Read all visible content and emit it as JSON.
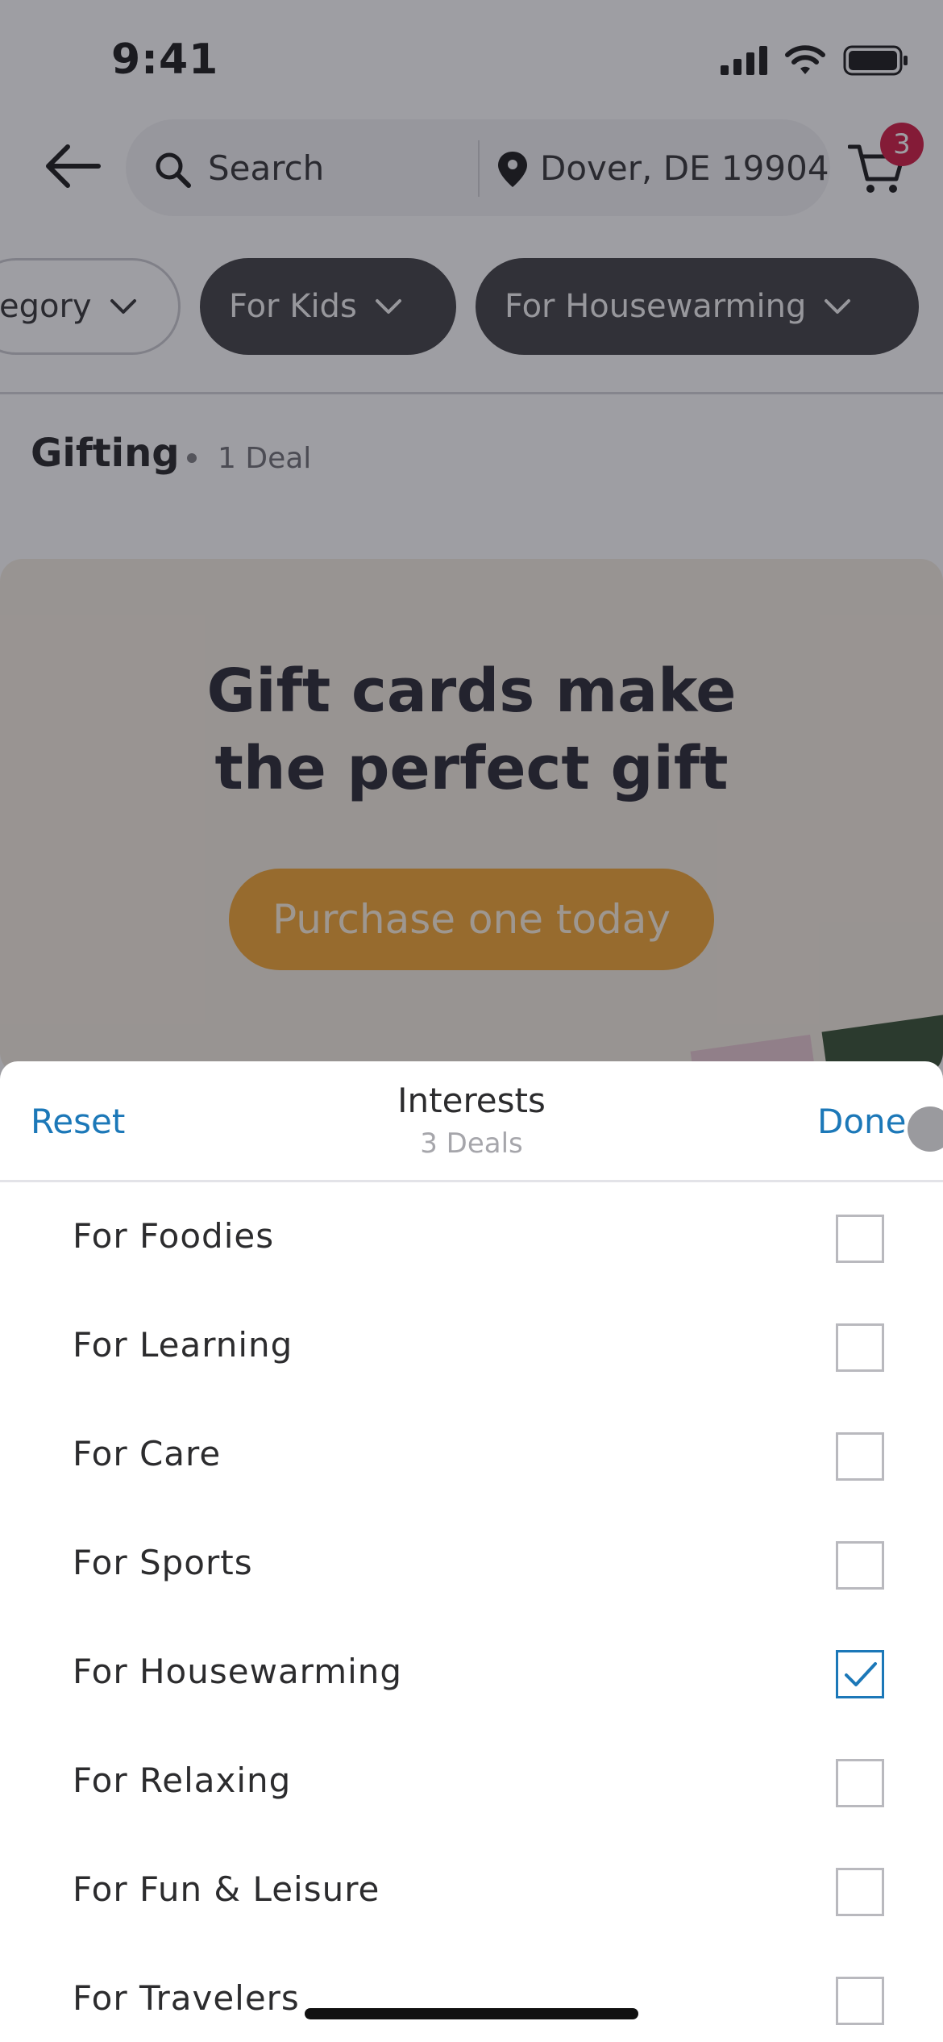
{
  "status_bar": {
    "time": "9:41"
  },
  "header": {
    "search_label": "Search",
    "location": "Dover, DE 19904",
    "cart_count": "3"
  },
  "chips": [
    {
      "label": "egory",
      "style": "outline"
    },
    {
      "label": "For Kids",
      "style": "filled"
    },
    {
      "label": "For Housewarming",
      "style": "filled"
    }
  ],
  "section": {
    "title": "Gifting",
    "count": "1 Deal"
  },
  "banner": {
    "headline_line1": "Gift cards make",
    "headline_line2": "the perfect gift",
    "cta": "Purchase one today"
  },
  "sheet": {
    "reset_label": "Reset",
    "done_label": "Done",
    "title": "Interests",
    "subtitle": "3 Deals",
    "options": [
      {
        "label": "For Foodies",
        "checked": false
      },
      {
        "label": "For Learning",
        "checked": false
      },
      {
        "label": "For Care",
        "checked": false
      },
      {
        "label": "For Sports",
        "checked": false
      },
      {
        "label": "For Housewarming",
        "checked": true
      },
      {
        "label": "For Relaxing",
        "checked": false
      },
      {
        "label": "For Fun & Leisure",
        "checked": false
      },
      {
        "label": "For Travelers",
        "checked": false
      }
    ]
  },
  "colors": {
    "accent_blue": "#1c78b8",
    "badge_red": "#d0123b",
    "cta_orange": "#f3a22a",
    "chip_dark": "#3a3a3c"
  }
}
